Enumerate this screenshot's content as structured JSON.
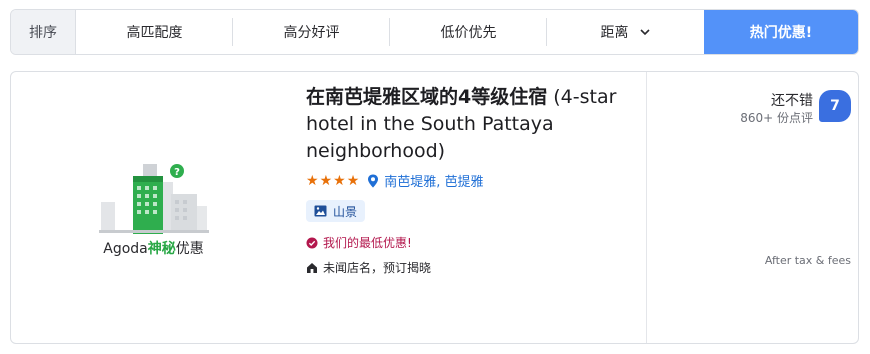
{
  "sort_bar": {
    "label": "排序",
    "options": [
      "高匹配度",
      "高分好评",
      "低价优先",
      "距离"
    ],
    "hot_button": "热门优惠!"
  },
  "hotel": {
    "image_label_prefix": "Agoda",
    "image_label_highlight": "神秘",
    "image_label_suffix": "优惠",
    "title_cn": "在南芭堤雅区域的4等级住宿",
    "title_en": " (4-star hotel in the South Pattaya neighborhood)",
    "stars": 4,
    "location": "南芭堤雅, 芭提雅",
    "view_tag": "山景",
    "deal_text": "我们的最低优惠!",
    "secret_text": "未闻店名，预订揭晓",
    "review_word": "还不错",
    "review_count": "860+ 份点评",
    "score": "7",
    "tax_note": "After tax & fees"
  },
  "colors": {
    "accent": "#5392f9",
    "score_bg": "#3a6fe0",
    "star": "#e8710a",
    "deal": "#b3174d",
    "mystery_green": "#28a745"
  }
}
